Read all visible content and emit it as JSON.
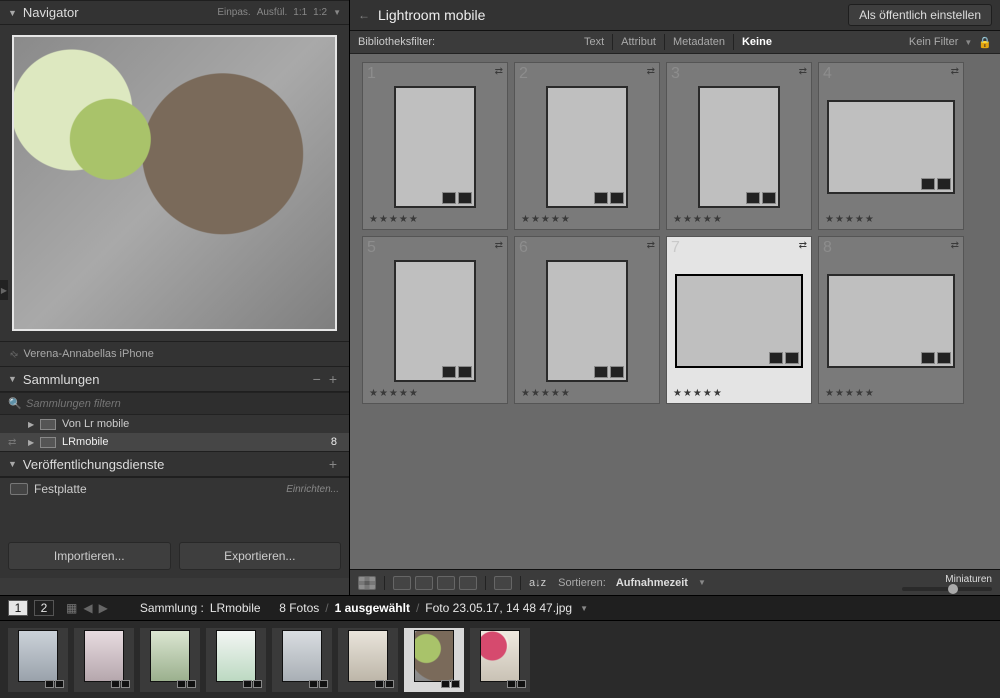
{
  "navigator": {
    "title": "Navigator",
    "zoom_fit": "Einpas.",
    "zoom_fill": "Ausfül.",
    "zoom_1_1": "1:1",
    "zoom_1_2": "1:2",
    "device": "Verena-Annabellas iPhone"
  },
  "collections": {
    "title": "Sammlungen",
    "filter_placeholder": "Sammlungen filtern",
    "items": [
      {
        "name": "Von Lr mobile",
        "count": ""
      },
      {
        "name": "LRmobile",
        "count": "8"
      }
    ]
  },
  "publish": {
    "title": "Veröffentlichungsdienste",
    "disk": "Festplatte",
    "setup": "Einrichten..."
  },
  "import_btn": "Importieren...",
  "export_btn": "Exportieren...",
  "right_header": {
    "title": "Lightroom mobile",
    "public_btn": "Als öffentlich einstellen"
  },
  "library_filter": {
    "label": "Bibliotheksfilter:",
    "tabs": [
      "Text",
      "Attribut",
      "Metadaten",
      "Keine"
    ],
    "active_tab": 3,
    "none_label": "Kein Filter"
  },
  "thumbs": [
    {
      "n": "1",
      "orient": "portrait",
      "scene": "sc1",
      "stars": "★★★★★"
    },
    {
      "n": "2",
      "orient": "portrait",
      "scene": "sc2",
      "stars": "★★★★★"
    },
    {
      "n": "3",
      "orient": "portrait",
      "scene": "sc3",
      "stars": "★★★★★"
    },
    {
      "n": "4",
      "orient": "landscape",
      "scene": "sc4",
      "stars": "★★★★★"
    },
    {
      "n": "5",
      "orient": "portrait",
      "scene": "sc5",
      "stars": "★★★★★"
    },
    {
      "n": "6",
      "orient": "portrait",
      "scene": "sc6",
      "stars": "★★★★★"
    },
    {
      "n": "7",
      "orient": "landscape",
      "scene": "sc7",
      "stars": "★★★★★",
      "selected": true
    },
    {
      "n": "8",
      "orient": "landscape",
      "scene": "sc8",
      "stars": "★★★★★"
    }
  ],
  "toolbar": {
    "sort_label": "Sortieren:",
    "sort_value": "Aufnahmezeit",
    "thumb_label": "Miniaturen"
  },
  "info": {
    "page1": "1",
    "page2": "2",
    "collection_label": "Sammlung :",
    "collection_name": "LRmobile",
    "count": "8 Fotos",
    "selected": "1 ausgewählt",
    "filename": "Foto 23.05.17, 14 48 47.jpg"
  }
}
